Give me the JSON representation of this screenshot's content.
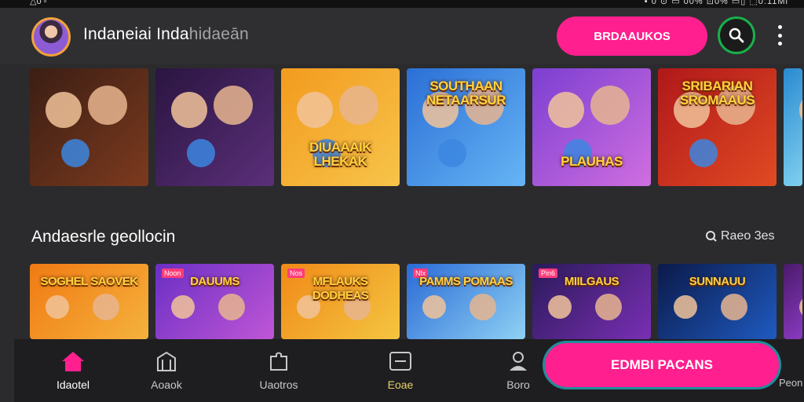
{
  "status_bar": {
    "left": "△0 ▫",
    "right": "▪ 0 ⊙ ▭ 00% ⊡0% ▭▯ ⬚0:11Mi"
  },
  "header": {
    "title_main": "Indaneiai Inda",
    "title_faded": "hidaeān",
    "cta_label": "BRDAAUKOS",
    "search_icon": "search-icon",
    "more_icon": "more-vert-icon"
  },
  "row1": {
    "cards": [
      {
        "title": "",
        "colors": [
          "#3b1e14",
          "#7c3a1e"
        ]
      },
      {
        "title": "",
        "colors": [
          "#2a1540",
          "#5b2f7a"
        ]
      },
      {
        "title": "DIUAAAIK LHEKAK",
        "colors": [
          "#f29b1f",
          "#f7c44a"
        ]
      },
      {
        "title": "SOUTHAAN NETAARSUR",
        "colors": [
          "#2b6fd6",
          "#66b5f5"
        ]
      },
      {
        "title": "PLAUHAS",
        "colors": [
          "#7b3fd1",
          "#d06ee0"
        ]
      },
      {
        "title": "SRIBARIAN SROMAAUS",
        "colors": [
          "#b0181a",
          "#e04a22"
        ]
      },
      {
        "title": "",
        "colors": [
          "#2a8ad0",
          "#7fd0f0"
        ]
      }
    ]
  },
  "section": {
    "title": "Andaesrle geollocin",
    "view_all_label": "Raeo 3es",
    "view_all_icon": "search-icon"
  },
  "row2": {
    "cards": [
      {
        "title": "SOGHEL SAOVEK",
        "badge": "",
        "colors": [
          "#f07a14",
          "#f5b23c"
        ]
      },
      {
        "title": "DAUUMS",
        "badge": "Noon",
        "colors": [
          "#6a2fc4",
          "#c056d6"
        ]
      },
      {
        "title": "MFLAUKS DODHEAS",
        "badge": "Nos",
        "colors": [
          "#f08a18",
          "#f4c540"
        ]
      },
      {
        "title": "PAMMS POMAAS",
        "badge": "Nlx",
        "colors": [
          "#2a6ad6",
          "#8fd2f4"
        ]
      },
      {
        "title": "MIILGAUS",
        "badge": "Pin6",
        "colors": [
          "#2a1a5a",
          "#7a2fb4"
        ]
      },
      {
        "title": "SUNNAUU",
        "badge": "",
        "colors": [
          "#0b1a4a",
          "#1f5ac0"
        ]
      },
      {
        "title": "",
        "badge": "",
        "colors": [
          "#4a1a6a",
          "#8a3ac0"
        ]
      }
    ]
  },
  "bottom_nav": {
    "items": [
      {
        "label": "Idaotel",
        "icon": "home-icon"
      },
      {
        "label": "Aoaok",
        "icon": "store-icon"
      },
      {
        "label": "Uaotros",
        "icon": "puzzle-icon"
      },
      {
        "label": "Eoae",
        "icon": "card-icon"
      },
      {
        "label": "Boro",
        "icon": "profile-icon"
      }
    ],
    "cta_label": "EDMBI PACANS",
    "edge_label": "Peon"
  },
  "colors": {
    "accent": "#ff1f8e",
    "search_ring": "#19b04a",
    "active_nav": "#ff1f8e"
  }
}
